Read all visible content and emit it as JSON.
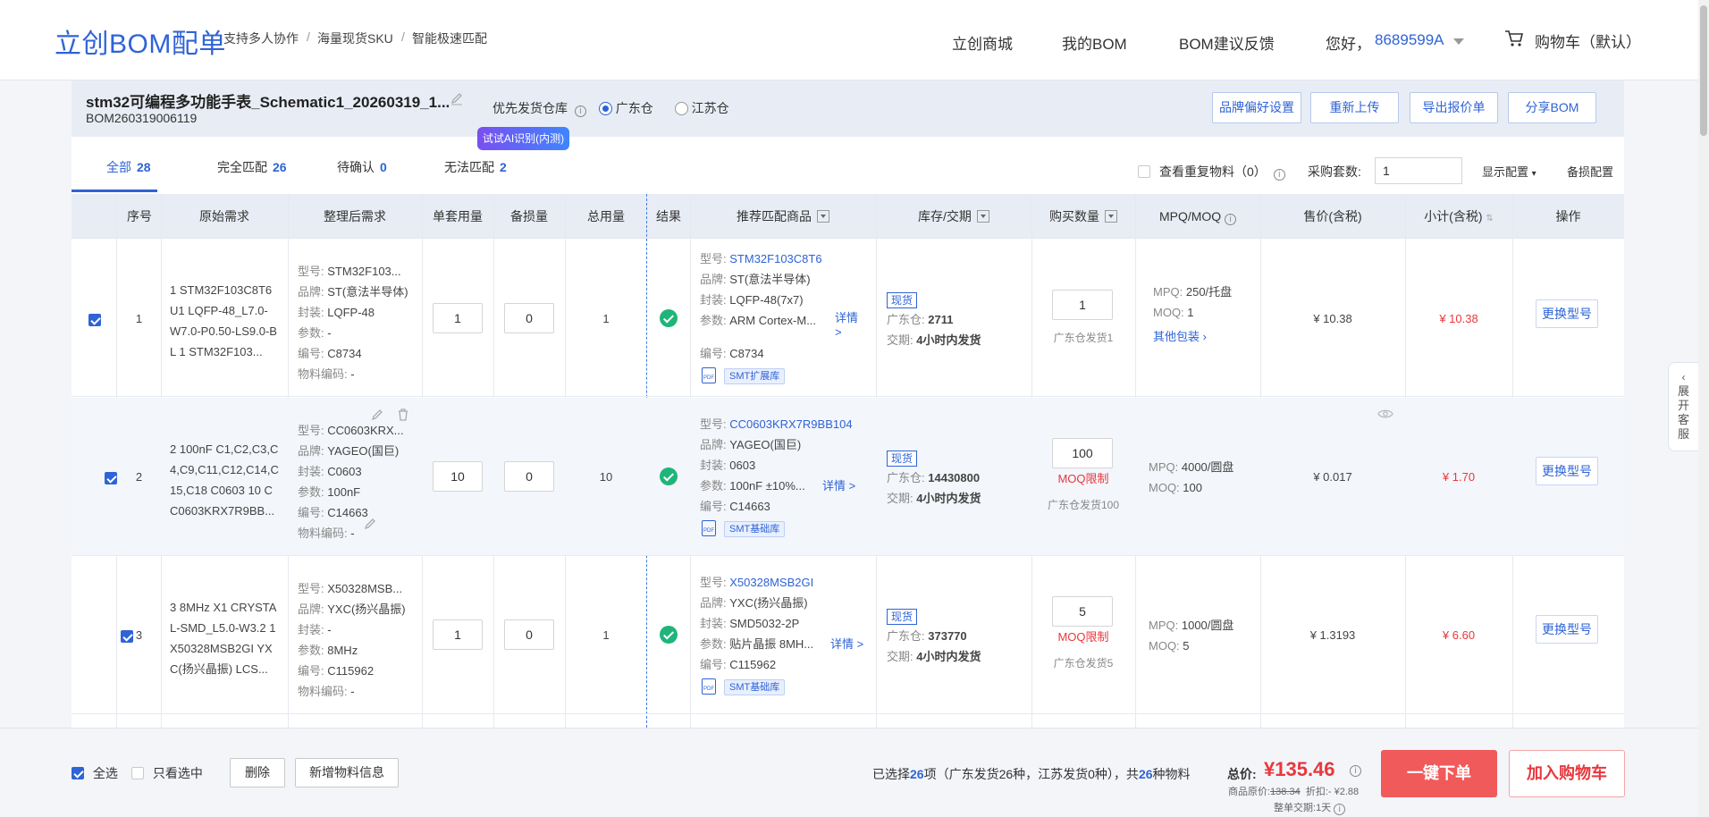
{
  "header": {
    "logo": "立创BOM配单",
    "crumbs": [
      "支持多人协作",
      "海量现货SKU",
      "智能极速匹配"
    ],
    "crumb_sep": "/",
    "nav": [
      "立创商城",
      "我的BOM",
      "BOM建议反馈"
    ],
    "greeting": "您好，",
    "user": "8689599A",
    "cart": "购物车（默认）"
  },
  "bom": {
    "title": "stm32可编程多功能手表_Schematic1_20260319_1...",
    "number": "BOM260319006119",
    "warehouse_label": "优先发货仓库",
    "warehouse_options": [
      "广东仓",
      "江苏仓"
    ],
    "warehouse_selected": "广东仓",
    "actions": [
      "品牌偏好设置",
      "重新上传",
      "导出报价单",
      "分享BOM"
    ]
  },
  "tabs": [
    {
      "label": "全部",
      "count": "28"
    },
    {
      "label": "完全匹配",
      "count": "26"
    },
    {
      "label": "待确认",
      "count": "0"
    },
    {
      "label": "无法匹配",
      "count": "2"
    }
  ],
  "ai_badge": "试试AI识别(内测)",
  "toolbar": {
    "dup_label": "查看重复物料（0）",
    "sets_label": "采购套数:",
    "sets_value": "1",
    "display_config": "显示配置",
    "loss_config": "备损配置"
  },
  "columns": [
    "序号",
    "原始需求",
    "整理后需求",
    "单套用量",
    "备损量",
    "总用量",
    "结果",
    "推荐匹配商品",
    "库存/交期",
    "购买数量",
    "MPQ/MOQ",
    "售价(含税)",
    "小计(含税)",
    "操作"
  ],
  "labels": {
    "model": "型号:",
    "brand": "品牌:",
    "package": "封装:",
    "param": "参数:",
    "code": "编号:",
    "material_code": "物料编码:",
    "in_stock": "现货",
    "gd": "广东仓:",
    "lead": "交期:",
    "details": "详情 >",
    "mpq": "MPQ:",
    "moq": "MOQ:",
    "change": "更换型号",
    "moq_limit": "MOQ限制",
    "other_pkg": "其他包装"
  },
  "rows": [
    {
      "idx": "1",
      "raw": "1 STM32F103C8T6 U1 LQFP-48_L7.0-W7.0-P0.50-LS9.0-BL 1 STM32F103...",
      "clean": {
        "model": "STM32F103...",
        "brand": "ST(意法半导体)",
        "package": "LQFP-48",
        "param": "-",
        "code": "C8734",
        "material": "-"
      },
      "per_set": "1",
      "loss": "0",
      "total": "1",
      "match": {
        "model": "STM32F103C8T6",
        "brand": "ST(意法半导体)",
        "package": "LQFP-48(7x7)",
        "param": "ARM Cortex-M...",
        "code": "C8734",
        "lib": "SMT扩展库"
      },
      "stock": "2711",
      "lead": "4小时内发货",
      "qty": "1",
      "ship_note": "广东仓发货1",
      "moq_limit": false,
      "mpq": "250/托盘",
      "moq": "1",
      "other_pkg": true,
      "price": "¥ 10.38",
      "subtotal": "¥ 10.38"
    },
    {
      "idx": "2",
      "raw": "2 100nF C1,C2,C3,C4,C9,C11,C12,C14,C15,C18 C0603 10 CC0603KRX7R9BB...",
      "clean": {
        "model": "CC0603KRX...",
        "brand": "YAGEO(国巨)",
        "package": "C0603",
        "param": "100nF",
        "code": "C14663",
        "material": "-"
      },
      "per_set": "10",
      "loss": "0",
      "total": "10",
      "match": {
        "model": "CC0603KRX7R9BB104",
        "brand": "YAGEO(国巨)",
        "package": "0603",
        "param": "100nF ±10%...",
        "code": "C14663",
        "lib": "SMT基础库"
      },
      "stock": "14430800",
      "lead": "4小时内发货",
      "qty": "100",
      "ship_note": "广东仓发货100",
      "moq_limit": true,
      "mpq": "4000/圆盘",
      "moq": "100",
      "other_pkg": false,
      "price": "¥ 0.017",
      "subtotal": "¥ 1.70"
    },
    {
      "idx": "3",
      "raw": "3 8MHz X1 CRYSTAL-SMD_L5.0-W3.2 1 X50328MSB2GI YXC(扬兴晶振) LCS...",
      "clean": {
        "model": "X50328MSB...",
        "brand": "YXC(扬兴晶振)",
        "package": "-",
        "param": "8MHz",
        "code": "C115962",
        "material": "-"
      },
      "per_set": "1",
      "loss": "0",
      "total": "1",
      "match": {
        "model": "X50328MSB2GI",
        "brand": "YXC(扬兴晶振)",
        "package": "SMD5032-2P",
        "param": "贴片晶振 8MH...",
        "code": "C115962",
        "lib": "SMT基础库"
      },
      "stock": "373770",
      "lead": "4小时内发货",
      "qty": "5",
      "ship_note": "广东仓发货5",
      "moq_limit": true,
      "mpq": "1000/圆盘",
      "moq": "5",
      "other_pkg": false,
      "price": "¥ 1.3193",
      "subtotal": "¥ 6.60"
    }
  ],
  "footer": {
    "select_all": "全选",
    "only_selected": "只看选中",
    "delete": "删除",
    "add_material": "新增物料信息",
    "summary_pre": "已选择",
    "summary_count": "26",
    "summary_mid": "项（广东发货26种，江苏发货0种），共",
    "summary_kinds": "26",
    "summary_post": "种物料",
    "total_label": "总价:",
    "total": "¥135.46",
    "orig_label": "商品原价:",
    "orig": "138.34",
    "discount_label": "折扣:",
    "discount": "- ¥2.88",
    "lead_label": "整单交期:",
    "lead": "1天",
    "order_btn": "一键下单",
    "cart_btn": "加入购物车"
  },
  "side_tab": "展开客服",
  "colors": {
    "accent": "#2f63d6",
    "price": "#e8383d",
    "ok": "#1fb57a",
    "order": "#f05a5a"
  }
}
